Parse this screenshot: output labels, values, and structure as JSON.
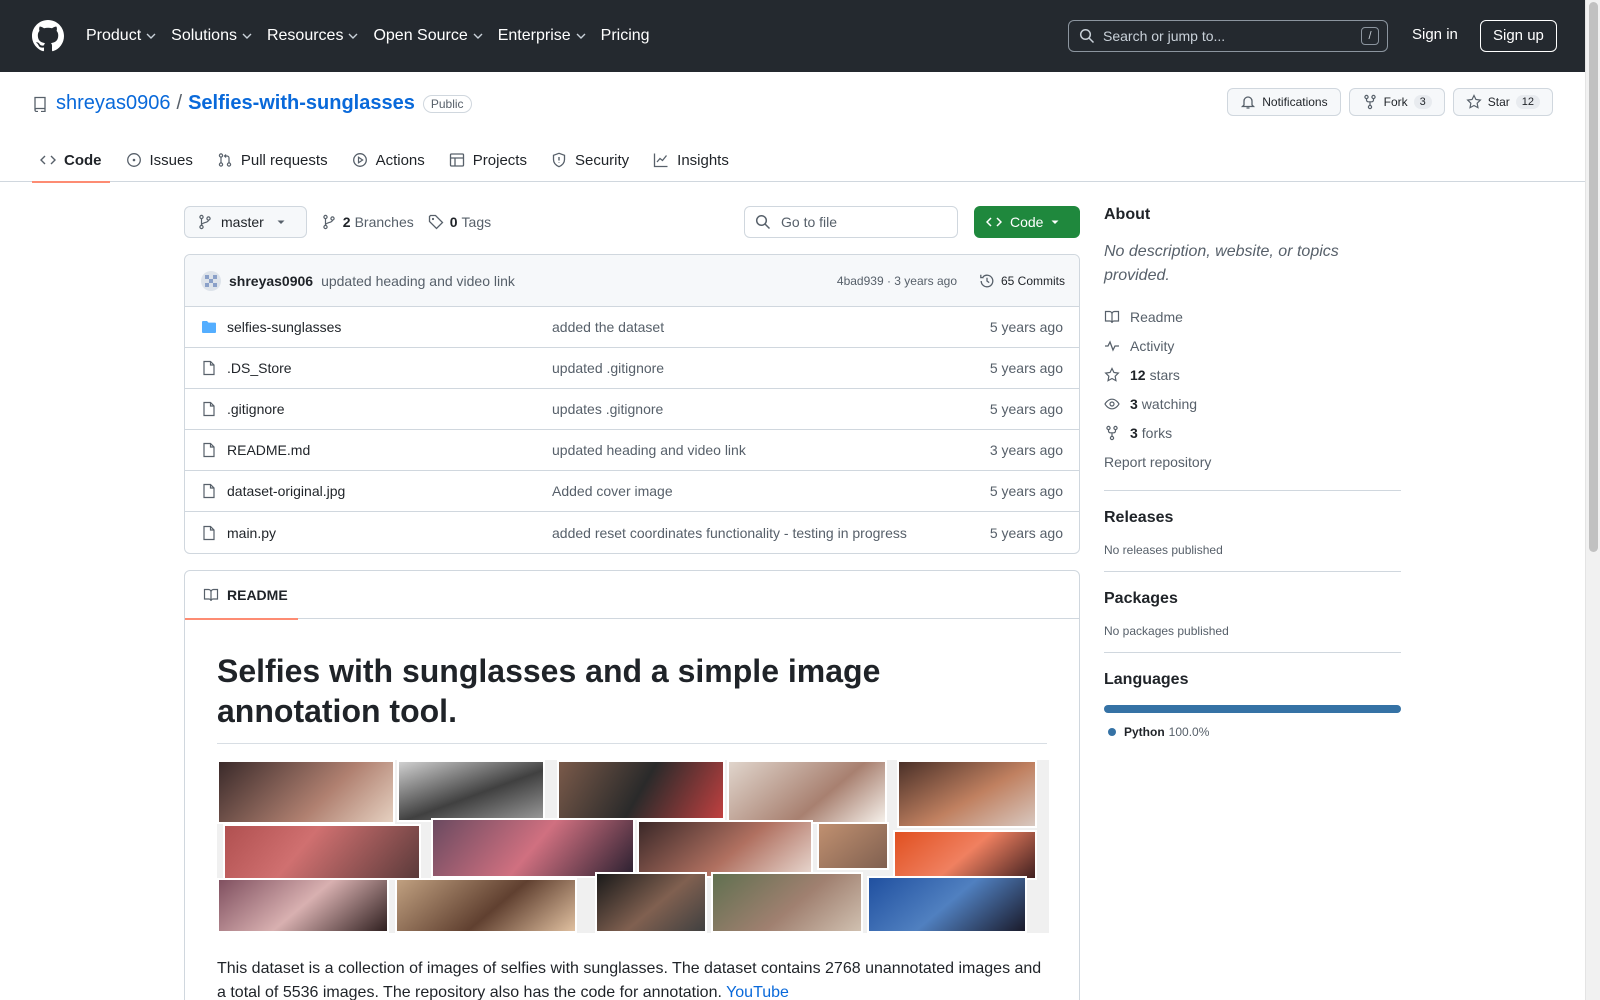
{
  "header": {
    "nav": [
      {
        "label": "Product",
        "has_menu": true
      },
      {
        "label": "Solutions",
        "has_menu": true
      },
      {
        "label": "Resources",
        "has_menu": true
      },
      {
        "label": "Open Source",
        "has_menu": true
      },
      {
        "label": "Enterprise",
        "has_menu": true
      },
      {
        "label": "Pricing",
        "has_menu": false
      }
    ],
    "search_placeholder": "Search or jump to...",
    "search_shortcut": "/",
    "sign_in": "Sign in",
    "sign_up": "Sign up"
  },
  "repo": {
    "owner": "shreyas0906",
    "separator": "/",
    "name": "Selfies-with-sunglasses",
    "visibility": "Public",
    "notifications_label": "Notifications",
    "fork_label": "Fork",
    "fork_count": "3",
    "star_label": "Star",
    "star_count": "12",
    "tabs": [
      {
        "label": "Code",
        "icon": "code-icon",
        "active": true
      },
      {
        "label": "Issues",
        "icon": "issue-icon",
        "active": false
      },
      {
        "label": "Pull requests",
        "icon": "pull-request-icon",
        "active": false
      },
      {
        "label": "Actions",
        "icon": "play-icon",
        "active": false
      },
      {
        "label": "Projects",
        "icon": "table-icon",
        "active": false
      },
      {
        "label": "Security",
        "icon": "shield-icon",
        "active": false
      },
      {
        "label": "Insights",
        "icon": "graph-icon",
        "active": false
      }
    ]
  },
  "toolbar": {
    "branch": "master",
    "branches_count": "2",
    "branches_label": "Branches",
    "tags_count": "0",
    "tags_label": "Tags",
    "goto_placeholder": "Go to file",
    "code_button": "Code"
  },
  "latest_commit": {
    "author": "shreyas0906",
    "message": "updated heading and video link",
    "meta": "4bad939 · 3 years ago",
    "commits_label": "65 Commits"
  },
  "files": [
    {
      "name": "selfies-sunglasses",
      "type": "folder",
      "message": "added the dataset",
      "age": "5 years ago"
    },
    {
      "name": ".DS_Store",
      "type": "file",
      "message": "updated .gitignore",
      "age": "5 years ago"
    },
    {
      "name": ".gitignore",
      "type": "file",
      "message": "updates .gitignore",
      "age": "5 years ago"
    },
    {
      "name": "README.md",
      "type": "file",
      "message": "updated heading and video link",
      "age": "3 years ago"
    },
    {
      "name": "dataset-original.jpg",
      "type": "file",
      "message": "Added cover image",
      "age": "5 years ago"
    },
    {
      "name": "main.py",
      "type": "file",
      "message": "added reset coordinates functionality - testing in progress",
      "age": "5 years ago"
    }
  ],
  "readme": {
    "tab_label": "README",
    "title": "Selfies with sunglasses and a simple image annotation tool.",
    "paragraph": "This dataset is a collection of images of selfies with sunglasses. The dataset contains 2768 unannotated images and a total of 5536 images. The repository also has the code for annotation.",
    "link_text": "YouTube"
  },
  "about": {
    "heading": "About",
    "description": "No description, website, or topics provided.",
    "links": [
      {
        "icon": "book-icon",
        "count": "",
        "label": "Readme"
      },
      {
        "icon": "pulse-icon",
        "count": "",
        "label": "Activity"
      },
      {
        "icon": "star-icon",
        "count": "12",
        "label": "stars"
      },
      {
        "icon": "eye-icon",
        "count": "3",
        "label": "watching"
      },
      {
        "icon": "fork-icon",
        "count": "3",
        "label": "forks"
      }
    ],
    "report": "Report repository"
  },
  "releases": {
    "heading": "Releases",
    "text": "No releases published"
  },
  "packages": {
    "heading": "Packages",
    "text": "No packages published"
  },
  "languages": {
    "heading": "Languages",
    "items": [
      {
        "name": "Python",
        "percent": "100.0%",
        "color": "#3572a5"
      }
    ]
  },
  "colors": {
    "header_bg": "#24292f",
    "accent_link": "#0969da",
    "code_button": "#1f883d",
    "active_tab_underline": "#fd8c73"
  }
}
